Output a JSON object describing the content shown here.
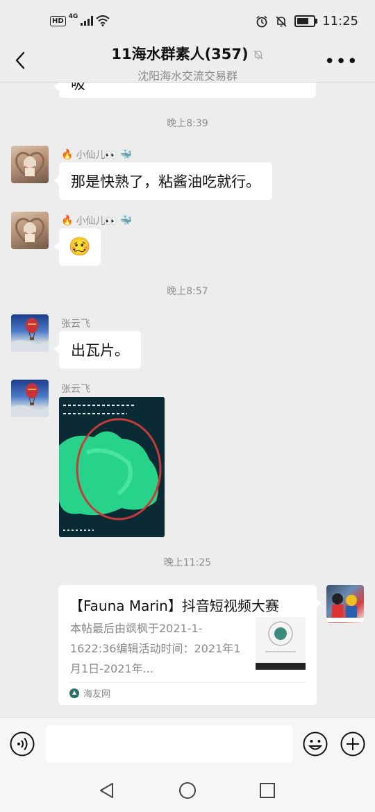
{
  "status_bar": {
    "hd": "HD",
    "network": "4G",
    "time": "11:25"
  },
  "header": {
    "title": "11海水群素人(357)",
    "subtitle": "沈阳海水交流交易群"
  },
  "messages": {
    "partial_text": "吸",
    "time1": "晚上8:39",
    "m1": {
      "sender": "小仙儿👀",
      "text": "那是快熟了，粘酱油吃就行。"
    },
    "m2": {
      "sender": "小仙儿👀",
      "emoji": "🥴"
    },
    "time2": "晚上8:57",
    "m3": {
      "sender": "张云飞",
      "text": "出瓦片。"
    },
    "m4": {
      "sender": "张云飞"
    },
    "time3": "晚上11:25",
    "card": {
      "title": "【Fauna Marin】抖音短视频大赛",
      "desc": "本帖最后由飒枫于2021-1-1622:36编辑活动时间：2021年1月1日-2021年...",
      "source": "海友网"
    }
  },
  "colors": {
    "background": "#ededed",
    "bubble": "#ffffff",
    "timestamp": "#8d8d8d"
  }
}
